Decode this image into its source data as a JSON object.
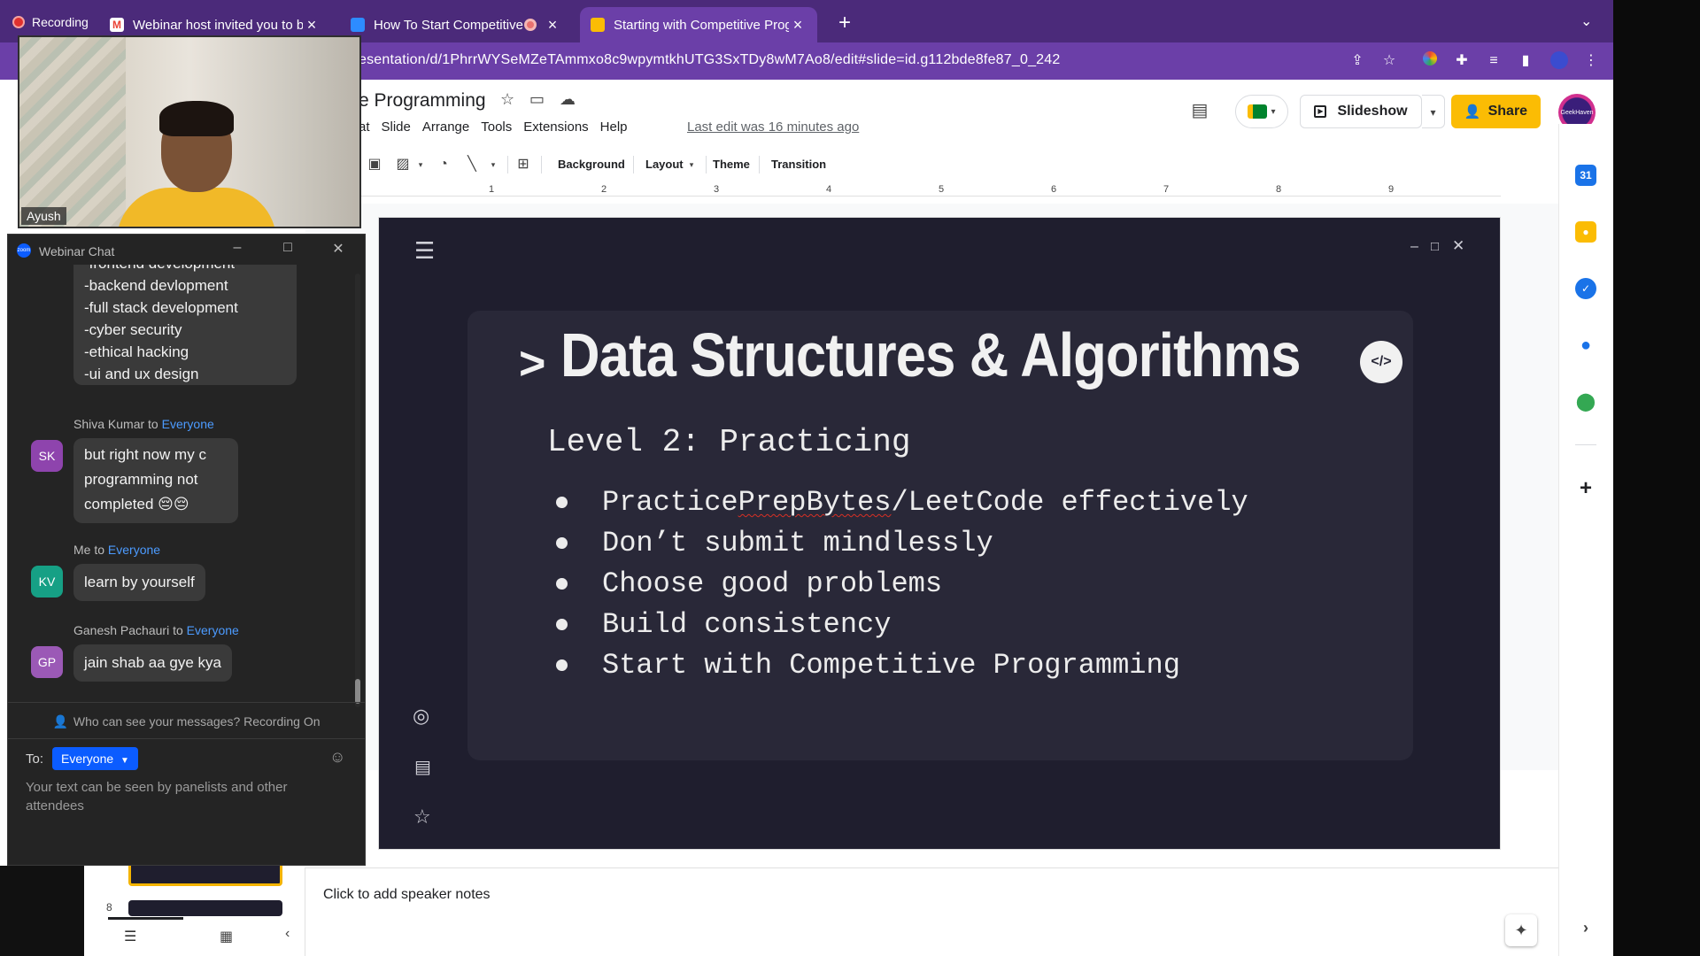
{
  "browser": {
    "recording_label": "Recording",
    "tabs": [
      {
        "title": "Webinar host invited you to be",
        "favicon_color": "#ea4335",
        "active": false
      },
      {
        "title": "How To Start Competitive P",
        "favicon_color": "#2d8cff",
        "active": false
      },
      {
        "title": "Starting with Competitive Prog",
        "favicon_color": "#fbbc04",
        "active": true
      }
    ],
    "url": "esentation/d/1PhrrWYSeMZeTAmmxo8c9wpymtkhUTG3SxTDy8wM7Ao8/edit#slide=id.g112bde8fe87_0_242"
  },
  "slides_app": {
    "doc_title": "e Programming",
    "menus": [
      "at",
      "Slide",
      "Arrange",
      "Tools",
      "Extensions",
      "Help"
    ],
    "last_edit": "Last edit was 16 minutes ago",
    "toolbar": {
      "background": "Background",
      "layout": "Layout",
      "theme": "Theme",
      "transition": "Transition"
    },
    "ruler_numbers": [
      "1",
      "2",
      "3",
      "4",
      "5",
      "6",
      "7",
      "8",
      "9"
    ],
    "slideshow_label": "Slideshow",
    "share_label": "Share",
    "speaker_notes_placeholder": "Click to add speaker notes",
    "filmstrip_slide_number": "8"
  },
  "slide": {
    "prompt": ">",
    "heading": "Data Structures & Algorithms",
    "level": "Level 2: Practicing",
    "bullets": [
      {
        "pre": "Practice ",
        "mark": "PrepBytes",
        "post": "/LeetCode effectively"
      },
      {
        "pre": "Don’t submit mindlessly",
        "mark": "",
        "post": ""
      },
      {
        "pre": "Choose good problems",
        "mark": "",
        "post": ""
      },
      {
        "pre": "Build consistency",
        "mark": "",
        "post": ""
      },
      {
        "pre": "Start with Competitive Programming",
        "mark": "",
        "post": ""
      }
    ]
  },
  "webcam": {
    "name": "Ayush"
  },
  "chat": {
    "title": "Webinar Chat",
    "first_bubble_lines": [
      "-frontend development",
      "-backend devlopment",
      "-full stack development",
      "-cyber security",
      "-ethical hacking",
      "-ui and ux design"
    ],
    "messages": [
      {
        "sender": "Shiva Kumar",
        "to_word": "to",
        "recipient": "Everyone",
        "initials": "SK",
        "avatar_color": "#8e44ad",
        "lines": [
          "but right now my c",
          "programming not",
          "completed 😔😔"
        ]
      },
      {
        "sender": "Me",
        "to_word": "to",
        "recipient": "Everyone",
        "initials": "KV",
        "avatar_color": "#16a085",
        "lines": [
          "learn by yourself"
        ]
      },
      {
        "sender": "Ganesh Pachauri",
        "to_word": "to",
        "recipient": "Everyone",
        "initials": "GP",
        "avatar_color": "#9b59b6",
        "lines": [
          "jain shab aa gye kya"
        ]
      }
    ],
    "privacy_notice": "Who can see your messages? Recording On",
    "to_label": "To:",
    "to_value": "Everyone",
    "input_placeholder": "Your text can be seen by panelists and other attendees"
  }
}
